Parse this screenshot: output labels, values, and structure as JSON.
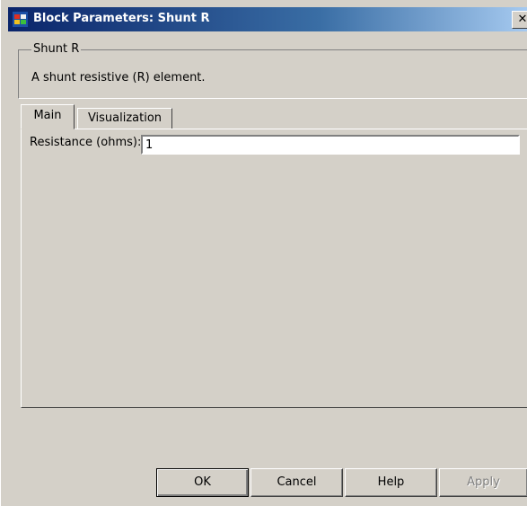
{
  "window": {
    "title": "Block Parameters: Shunt R",
    "close_label": "✕"
  },
  "group": {
    "title": "Shunt R",
    "description": "A shunt resistive (R) element."
  },
  "tabs": [
    {
      "label": "Main",
      "selected": true
    },
    {
      "label": "Visualization",
      "selected": false
    }
  ],
  "main": {
    "resistance_label": "Resistance (ohms):",
    "resistance_value": "1"
  },
  "buttons": {
    "ok": "OK",
    "cancel": "Cancel",
    "help": "Help",
    "apply": "Apply"
  },
  "colors": {
    "titlebar_start": "#0a246a",
    "titlebar_end": "#a6caf0",
    "face": "#d4d0c8"
  },
  "icons": {
    "title": "simulink-block-icon"
  }
}
